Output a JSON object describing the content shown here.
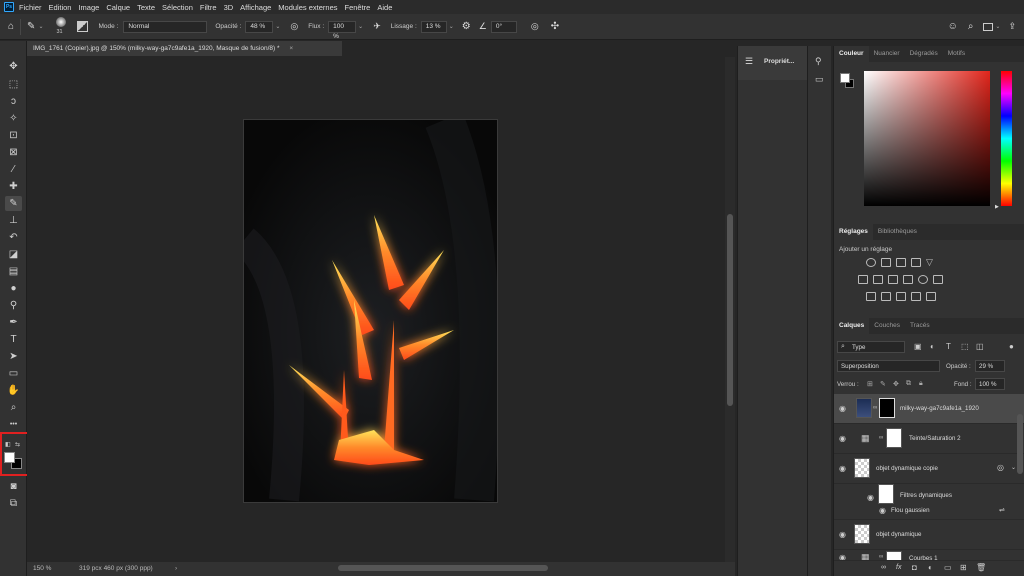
{
  "menubar": {
    "logo": "Ps",
    "items": [
      "Fichier",
      "Edition",
      "Image",
      "Calque",
      "Texte",
      "Sélection",
      "Filtre",
      "3D",
      "Affichage",
      "Modules externes",
      "Fenêtre",
      "Aide"
    ]
  },
  "options": {
    "brush_size": "31",
    "mode_label": "Mode :",
    "mode_value": "Normal",
    "opacity_label": "Opacité :",
    "opacity_value": "48 %",
    "flux_label": "Flux :",
    "flux_value": "100 %",
    "lissage_label": "Lissage :",
    "lissage_value": "13 %",
    "angle_value": "0°"
  },
  "document": {
    "tab_title": "IMG_1761 (Copier).jpg @ 150% (milky-way-ga7c9afe1a_1920, Masque de fusion/8) *",
    "tab_close": "×",
    "zoom": "150 %",
    "dimensions": "319 pcx 460 px (300 ppp)"
  },
  "properties_strip": {
    "label": "Propriét..."
  },
  "color_panel": {
    "tabs": [
      "Couleur",
      "Nuancier",
      "Dégradés",
      "Motifs"
    ],
    "accent": "#e1251b"
  },
  "adjust_panel": {
    "tabs": [
      "Réglages",
      "Bibliothèques"
    ],
    "add_label": "Ajouter un réglage"
  },
  "layers_panel": {
    "tabs": [
      "Calques",
      "Couches",
      "Tracés"
    ],
    "filter_value": "Type",
    "blend_mode": "Superposition",
    "opacity_label": "Opacité :",
    "opacity_value": "29 %",
    "lock_label": "Verrou :",
    "fill_label": "Fond :",
    "fill_value": "100 %",
    "layers": [
      {
        "name": "milky-way-ga7c9afe1a_1920"
      },
      {
        "name": "Teinte/Saturation 2"
      },
      {
        "name": "objet dynamique copie"
      },
      {
        "name": "Filtres dynamiques"
      },
      {
        "name": "Flou gaussien"
      },
      {
        "name": "objet dynamique"
      },
      {
        "name": "Courbes 1"
      }
    ],
    "footer_fx": "fx"
  }
}
